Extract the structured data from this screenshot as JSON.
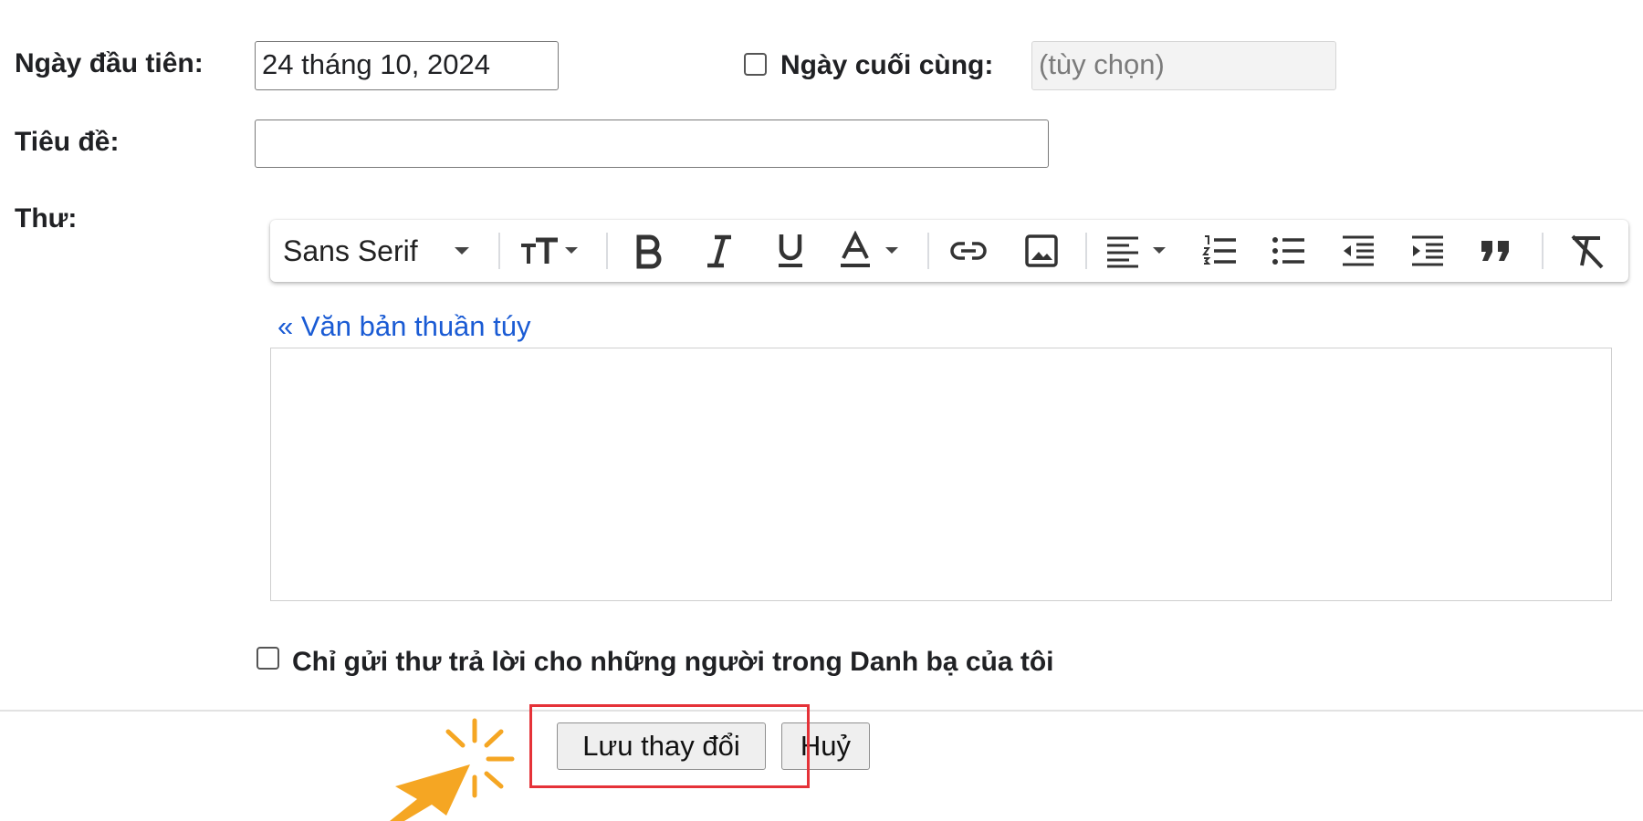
{
  "form": {
    "first_day_label": "Ngày đầu tiên:",
    "first_day_value": "24 tháng 10, 2024",
    "last_day_label": "Ngày cuối cùng:",
    "last_day_placeholder": "(tùy chọn)",
    "last_day_checked": false,
    "subject_label": "Tiêu đề:",
    "subject_value": "",
    "message_label": "Thư:",
    "plain_text_link": "« Văn bản thuần túy",
    "message_value": "",
    "contacts_only_label": "Chỉ gửi thư trả lời cho những người trong Danh bạ của tôi",
    "contacts_only_checked": false
  },
  "toolbar": {
    "font_family": "Sans Serif",
    "tools": [
      "font-family-select",
      "font-size",
      "bold",
      "italic",
      "underline",
      "text-color",
      "link",
      "image",
      "align",
      "numbered-list",
      "bulleted-list",
      "indent-less",
      "indent-more",
      "quote",
      "remove-formatting"
    ]
  },
  "actions": {
    "save_label": "Lưu thay đổi",
    "cancel_label": "Huỷ"
  },
  "annotation": {
    "highlight_color": "#e53238",
    "cursor_color": "#f5a623"
  }
}
